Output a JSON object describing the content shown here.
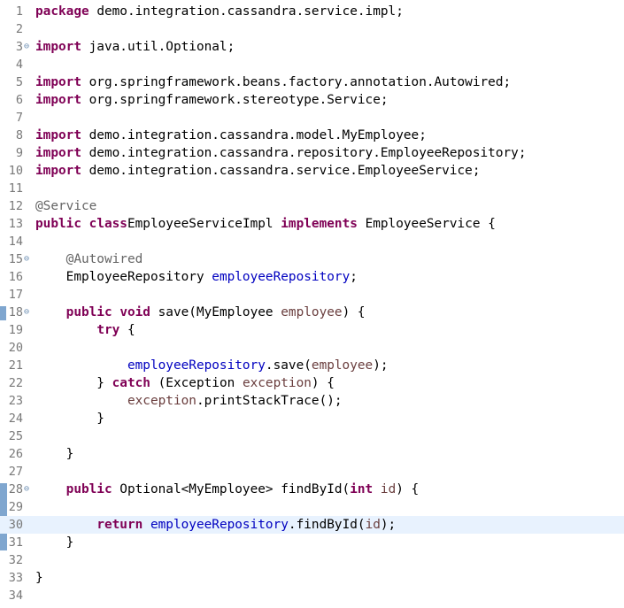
{
  "editor": {
    "current_line": 30,
    "colors": {
      "keyword": "#7f0055",
      "annotation": "#646464",
      "field": "#0000c0",
      "parameter": "#6a3e3e",
      "current_line_bg": "#e8f2fe"
    }
  },
  "lines": [
    {
      "n": "1",
      "fold": false,
      "code": [
        [
          "kw",
          "package"
        ],
        [
          "",
          "  demo.integration.cassandra.service.impl;"
        ]
      ]
    },
    {
      "n": "2",
      "fold": false,
      "code": []
    },
    {
      "n": "3",
      "fold": true,
      "code": [
        [
          "kw",
          "import"
        ],
        [
          "",
          "  java.util.Optional;"
        ]
      ]
    },
    {
      "n": "4",
      "fold": false,
      "code": []
    },
    {
      "n": "5",
      "fold": false,
      "code": [
        [
          "kw",
          "import"
        ],
        [
          "",
          "  org.springframework.beans.factory.annotation.Autowired;"
        ]
      ]
    },
    {
      "n": "6",
      "fold": false,
      "code": [
        [
          "kw",
          "import"
        ],
        [
          "",
          "  org.springframework.stereotype.Service;"
        ]
      ]
    },
    {
      "n": "7",
      "fold": false,
      "code": []
    },
    {
      "n": "8",
      "fold": false,
      "code": [
        [
          "kw",
          "import"
        ],
        [
          "",
          "  demo.integration.cassandra.model.MyEmployee;"
        ]
      ]
    },
    {
      "n": "9",
      "fold": false,
      "code": [
        [
          "kw",
          "import"
        ],
        [
          "",
          "  demo.integration.cassandra.repository.EmployeeRepository;"
        ]
      ]
    },
    {
      "n": "10",
      "fold": false,
      "code": [
        [
          "kw",
          "import"
        ],
        [
          "",
          "  demo.integration.cassandra.service.EmployeeService;"
        ]
      ]
    },
    {
      "n": "11",
      "fold": false,
      "code": []
    },
    {
      "n": "12",
      "fold": false,
      "code": [
        [
          "ann",
          "@Service"
        ]
      ]
    },
    {
      "n": "13",
      "fold": false,
      "code": [
        [
          "kw",
          "public"
        ],
        [
          "",
          " "
        ],
        [
          "kw",
          "class"
        ],
        [
          "",
          "",
          " "
        ],
        [
          "",
          "EmployeeServiceImpl "
        ],
        [
          "kw",
          "implements"
        ],
        [
          "",
          " EmployeeService {"
        ]
      ]
    },
    {
      "n": "14",
      "fold": false,
      "code": []
    },
    {
      "n": "15",
      "fold": true,
      "code": [
        [
          "",
          "    "
        ],
        [
          "ann",
          "@Autowired"
        ]
      ]
    },
    {
      "n": "16",
      "fold": false,
      "code": [
        [
          "",
          "    EmployeeRepository "
        ],
        [
          "fld",
          "employeeRepository"
        ],
        [
          "",
          ";"
        ]
      ]
    },
    {
      "n": "17",
      "fold": false,
      "code": []
    },
    {
      "n": "18",
      "fold": true,
      "code": [
        [
          "",
          "    "
        ],
        [
          "kw",
          "public"
        ],
        [
          "",
          " "
        ],
        [
          "kw",
          "void"
        ],
        [
          "",
          " save(MyEmployee "
        ],
        [
          "prm",
          "employee"
        ],
        [
          "",
          ") {"
        ]
      ]
    },
    {
      "n": "19",
      "fold": false,
      "code": [
        [
          "",
          "        "
        ],
        [
          "kw",
          "try"
        ],
        [
          "",
          " {"
        ]
      ]
    },
    {
      "n": "20",
      "fold": false,
      "code": []
    },
    {
      "n": "21",
      "fold": false,
      "code": [
        [
          "",
          "            "
        ],
        [
          "fld",
          "employeeRepository"
        ],
        [
          "",
          ".save("
        ],
        [
          "prm",
          "employee"
        ],
        [
          "",
          ");"
        ]
      ]
    },
    {
      "n": "22",
      "fold": false,
      "code": [
        [
          "",
          "        } "
        ],
        [
          "kw",
          "catch"
        ],
        [
          "",
          " (Exception "
        ],
        [
          "prm",
          "exception"
        ],
        [
          "",
          ") {"
        ]
      ]
    },
    {
      "n": "23",
      "fold": false,
      "code": [
        [
          "",
          "            "
        ],
        [
          "prm",
          "exception"
        ],
        [
          "",
          ".printStackTrace();"
        ]
      ]
    },
    {
      "n": "24",
      "fold": false,
      "code": [
        [
          "",
          "        }"
        ]
      ]
    },
    {
      "n": "25",
      "fold": false,
      "code": []
    },
    {
      "n": "26",
      "fold": false,
      "code": [
        [
          "",
          "    }"
        ]
      ]
    },
    {
      "n": "27",
      "fold": false,
      "code": []
    },
    {
      "n": "28",
      "fold": true,
      "code": [
        [
          "",
          "    "
        ],
        [
          "kw",
          "public"
        ],
        [
          "",
          " Optional<MyEmployee> findById("
        ],
        [
          "kw",
          "int"
        ],
        [
          "",
          " "
        ],
        [
          "prm",
          "id"
        ],
        [
          "",
          ") {"
        ]
      ]
    },
    {
      "n": "29",
      "fold": false,
      "code": []
    },
    {
      "n": "30",
      "fold": false,
      "code": [
        [
          "",
          "        "
        ],
        [
          "kw",
          "return"
        ],
        [
          "",
          " "
        ],
        [
          "fld",
          "employeeRepository"
        ],
        [
          "",
          ".findById("
        ],
        [
          "prm",
          "id"
        ],
        [
          "",
          ");"
        ]
      ]
    },
    {
      "n": "31",
      "fold": false,
      "code": [
        [
          "",
          "    }"
        ]
      ]
    },
    {
      "n": "32",
      "fold": false,
      "code": []
    },
    {
      "n": "33",
      "fold": false,
      "code": [
        [
          "",
          "}"
        ]
      ]
    },
    {
      "n": "34",
      "fold": false,
      "code": []
    }
  ]
}
